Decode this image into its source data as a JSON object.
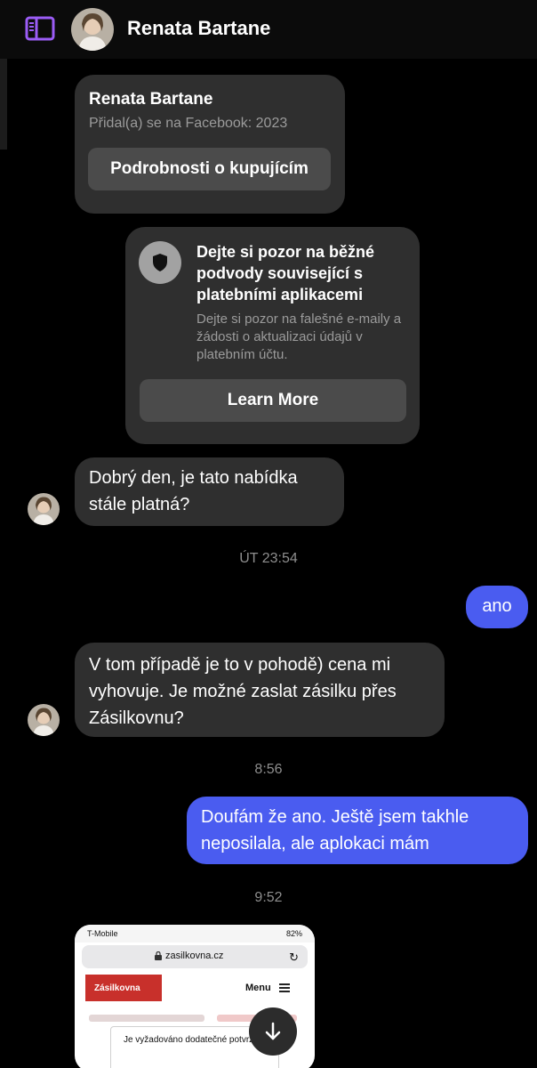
{
  "header": {
    "contact_name": "Renata Bartane",
    "sidebar_icon": "sidebar-toggle-icon"
  },
  "profile_card": {
    "name": "Renata Bartane",
    "joined": "Přidal(a) se na Facebook: 2023",
    "button_label": "Podrobnosti o kupujícím"
  },
  "warning_card": {
    "icon": "shield-icon",
    "title": "Dejte si pozor na běžné podvody související s platebními aplikacemi",
    "body": "Dejte si pozor na falešné e-maily a žádosti o aktualizaci údajů v platebním účtu.",
    "button_label": "Learn More"
  },
  "messages": [
    {
      "direction": "in",
      "text": "Dobrý den, je tato nabídka stále platná?"
    },
    {
      "direction": "out",
      "text": "ano"
    },
    {
      "direction": "in",
      "text": "V tom případě je to v pohodě) cena mi vyhovuje. Je možné zaslat zásilku přes Zásilkovnu?"
    },
    {
      "direction": "out",
      "text": "Doufám že ano. Ještě jsem  takhle neposilala, ale aplokaci mám"
    }
  ],
  "timestamps": [
    "ÚT 23:54",
    "8:56",
    "9:52"
  ],
  "screenshot_attachment": {
    "carrier": "T-Mobile",
    "battery": "82%",
    "url": "zasilkovna.cz",
    "logo_text": "Zásilkovna",
    "menu_label": "Menu",
    "dialog_text": "Je vyžadováno dodatečné potvrzení"
  },
  "colors": {
    "background": "#000000",
    "incoming_bubble": "#2f2f2f",
    "outgoing_bubble": "#4a5cf0",
    "accent_icon": "#9b5cf6"
  }
}
